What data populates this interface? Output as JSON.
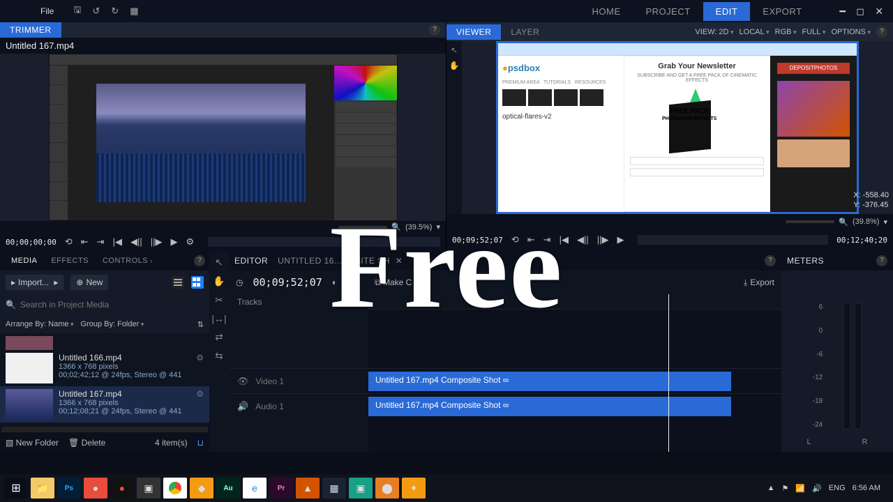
{
  "titlebar": {
    "file": "File",
    "nav": {
      "home": "HOME",
      "project": "PROJECT",
      "edit": "EDIT",
      "export": "EXPORT"
    }
  },
  "trimmer": {
    "tab": "TRIMMER",
    "clip": "Untitled 167.mp4",
    "zoom": "(39.5%)"
  },
  "viewer": {
    "tab_viewer": "VIEWER",
    "tab_layer": "LAYER",
    "opts": {
      "view": "VIEW: 2D",
      "local": "LOCAL",
      "rgb": "RGB",
      "full": "FULL",
      "options": "OPTIONS"
    },
    "newsletter": {
      "title": "Grab Your Newsletter",
      "sub": "SUBSCRIBE AND GET A FREE PACK OF CINEMATIC EFFECTS",
      "pack1": "FREE PACK",
      "pack2": "PHOTOSHOP EFFECTS"
    },
    "psdbox": "psdbox",
    "of": "optical-flares-v2",
    "deposit": "DEPOSITPHOTOS",
    "coords_x": "X: -558.40",
    "coords_y": "Y: -376.45",
    "zoom": "(39.8%)"
  },
  "transport": {
    "left_tc": "00;00;00;00",
    "right_tc": "00;09;52;07",
    "right_end": "00;12;40;20"
  },
  "media": {
    "tabs": {
      "media": "MEDIA",
      "effects": "EFFECTS",
      "controls": "CONTROLS"
    },
    "import": "Import...",
    "new": "New",
    "search_ph": "Search in Project Media",
    "arrange": "Arrange By: Name",
    "group": "Group By: Folder",
    "items": [
      {
        "title": "Untitled 166.mp4",
        "res": "1366 x 768 pixels",
        "dur": "00;02;42;12 @ 24fps, Stereo @ 441"
      },
      {
        "title": "Untitled 167.mp4",
        "res": "1366 x 768 pixels",
        "dur": "00;12;08;21 @ 24fps, Stereo @ 441"
      }
    ],
    "foot": {
      "newfolder": "New Folder",
      "delete": "Delete",
      "count": "4 item(s)"
    }
  },
  "editor": {
    "tab": "EDITOR",
    "clip": "UNTITLED 16...POSITE SH",
    "tc": "00;09;52;07",
    "make": "Make C",
    "export": "Export",
    "tracks": "Tracks",
    "track_video": "Video 1",
    "track_audio": "Audio 1",
    "clip_label": "Untitled 167.mp4 Composite Shot  ∞"
  },
  "meters": {
    "tab": "METERS",
    "scale": [
      "6",
      "0",
      "-6",
      "-12",
      "-18",
      "-24"
    ],
    "l": "L",
    "r": "R"
  },
  "taskbar": {
    "lang": "ENG",
    "time": "6:56 AM"
  },
  "overlay": "Free"
}
